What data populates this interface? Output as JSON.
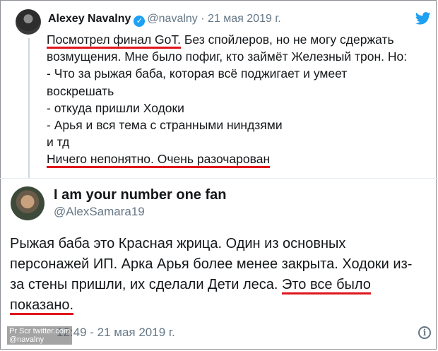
{
  "quoted_tweet": {
    "author_name": "Alexey Navalny",
    "handle": "@navalny",
    "date": "· 21 мая 2019 г.",
    "lines": [
      "Посмотрел финал GoT. Без спойлеров, но не могу сдержать",
      "возмущения. Мне было пофиг, кто займёт Железный трон. Но:",
      "- Что за рыжая баба, которая всё поджигает и умеет",
      "воскрешать",
      "- откуда пришли Ходоки",
      "- Арья и вся тема с странными ниндзями",
      "и тд",
      "Ничего непонятно. Очень разочарован"
    ],
    "line1_underlined": "Посмотрел финал GoT.",
    "line1_rest": " Без спойлеров, но не могу сдержать"
  },
  "reply": {
    "author_name": "I am your number one fan",
    "handle": "@AlexSamara19",
    "lines": [
      "Рыжая баба это Красная жрица. Один из основных",
      "персонажей ИП. Арка Арья более менее закрыта. Ходоки из-",
      "за стены пришли, их сделали Дети леса."
    ],
    "underlined_tail": "Это все было",
    "last_line": "показано.",
    "timestamp": "12:49 - 21 мая 2019 г."
  },
  "watermark": {
    "line1": "Pr Scr twitter.com",
    "line2": "@navalny"
  },
  "colors": {
    "underline": "#e0161d",
    "verified": "#1da1f2",
    "muted": "#657786"
  },
  "icons": [
    "verified-badge-icon",
    "twitter-bird-icon",
    "info-icon"
  ]
}
